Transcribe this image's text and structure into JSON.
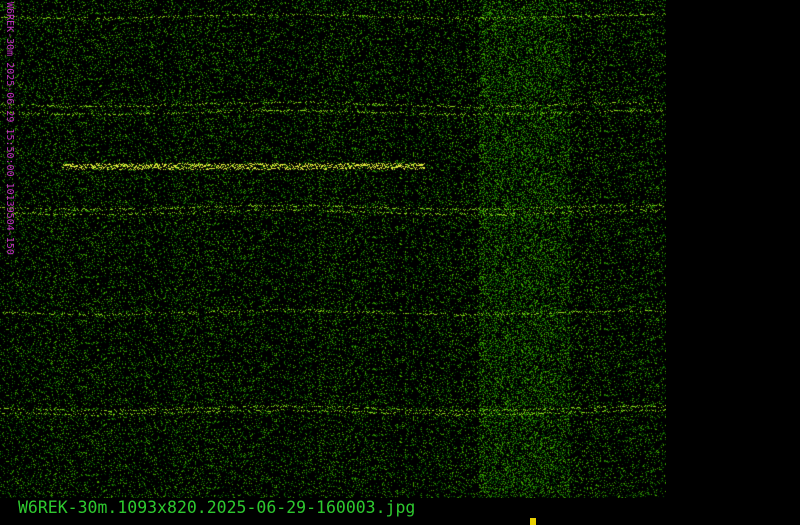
{
  "waterfall": {
    "vertical_caption": "W6REK-30m 2025-06-29 15:50:00 10139504-150",
    "colors": {
      "background": "#000000",
      "noise": "#2a7a10",
      "signal": "#b8f020",
      "strong_signal": "#f0f040",
      "caption": "#c030c0"
    }
  },
  "footer": {
    "filename": "W6REK-30m.1093x820.2025-06-29-160003.jpg",
    "text_color": "#2ec82e",
    "marker_color": "#e8d000"
  }
}
